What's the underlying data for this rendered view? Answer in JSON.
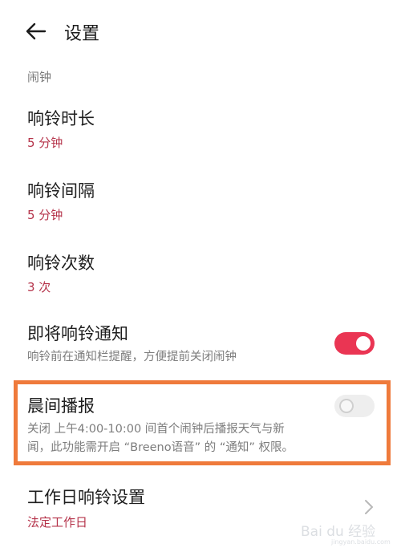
{
  "header": {
    "title": "设置"
  },
  "section": {
    "label": "闹钟"
  },
  "items": [
    {
      "title": "响铃时长",
      "value": "5 分钟"
    },
    {
      "title": "响铃间隔",
      "value": "5 分钟"
    },
    {
      "title": "响铃次数",
      "value": "3 次"
    },
    {
      "title": "即将响铃通知",
      "desc": "响铃前在通知栏提醒，方便提前关闭闹钟",
      "toggle": "on"
    },
    {
      "title": "晨间播报",
      "desc_line1": "关闭 上午4:00-10:00 间首个闹钟后播报天气与新",
      "desc_line2": "闻，此功能需开启 “Breeno语音” 的 “通知” 权限。",
      "toggle": "off"
    },
    {
      "title": "工作日响铃设置",
      "value": "法定工作日"
    }
  ],
  "colors": {
    "accent": "#ea3553",
    "value_text": "#b5334a",
    "highlight": "#ef7a3b"
  },
  "watermark": {
    "text": "Bai du 经验",
    "sub": "jingyan.baidu.com"
  }
}
